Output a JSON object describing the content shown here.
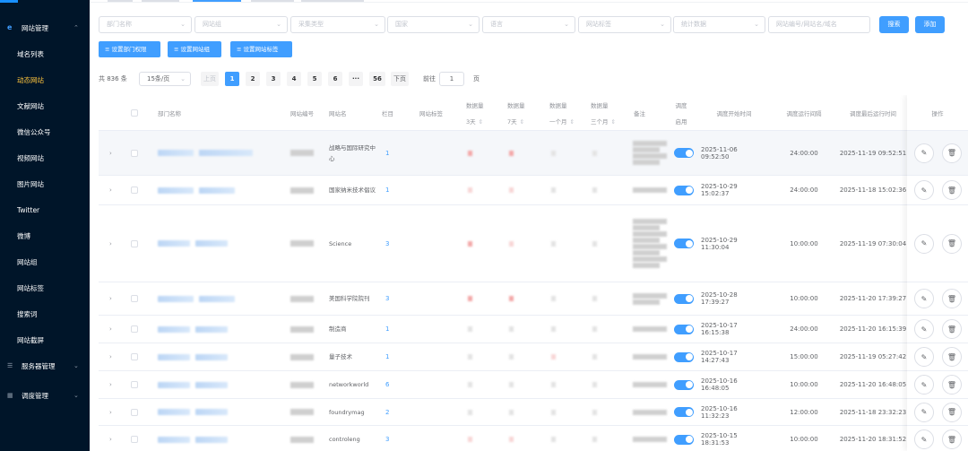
{
  "colors": {
    "primary": "#409eff",
    "sidebar_bg": "#001529",
    "active_menu": "#ffc53d"
  },
  "sidebar": {
    "top_menu": {
      "icon": "ie-icon",
      "label": "网站管理"
    },
    "items": [
      {
        "label": "域名列表",
        "active": false
      },
      {
        "label": "动态网站",
        "active": true
      },
      {
        "label": "文献网站",
        "active": false
      },
      {
        "label": "微信公众号",
        "active": false
      },
      {
        "label": "视频网站",
        "active": false
      },
      {
        "label": "图片网站",
        "active": false
      },
      {
        "label": "Twitter",
        "active": false
      },
      {
        "label": "微博",
        "active": false
      },
      {
        "label": "网站组",
        "active": false
      },
      {
        "label": "网站标签",
        "active": false
      },
      {
        "label": "搜索词",
        "active": false
      },
      {
        "label": "网站截屏",
        "active": false
      }
    ],
    "groups": [
      {
        "icon": "server-icon",
        "label": "服务器管理"
      },
      {
        "icon": "calendar-icon",
        "label": "调度管理"
      }
    ]
  },
  "filters": {
    "placeholders": [
      "部门名称",
      "网站组",
      "采集类型",
      "国家",
      "语言",
      "网站标签",
      "统计数据"
    ],
    "search_placeholder": "网站编号/网站名/域名",
    "search_label": "搜索",
    "add_label": "添加"
  },
  "actions": {
    "set_dept_perm": "设置部门权限",
    "set_site_group": "设置网站组",
    "set_site_tag": "设置网站标签"
  },
  "pager": {
    "total": "共 836 条",
    "page_size": "15条/页",
    "prev": "上页",
    "pages": [
      "1",
      "2",
      "3",
      "4",
      "5",
      "6",
      "···",
      "56"
    ],
    "next": "下页",
    "goto": "前往",
    "current": "1",
    "page_suffix": "页"
  },
  "table": {
    "headers": {
      "dept": "部门名称",
      "site_no": "网站编号",
      "site_name": "网站名",
      "column": "栏目",
      "tag": "网站标签",
      "d3_a": "数据量",
      "d3_b": "3天",
      "d7_a": "数据量",
      "d7_b": "7天",
      "d1m_a": "数据量",
      "d1m_b": "一个月",
      "d3m_a": "数据量",
      "d3m_b": "三个月",
      "remark": "备注",
      "sched_a": "调度",
      "sched_b": "启用",
      "start": "调度开始时间",
      "interval": "调度运行间隔",
      "last": "调度最后运行时间",
      "ops": "操作"
    },
    "rows": [
      {
        "name": "战略与国际研究中心",
        "column": "1",
        "start": "2025-11-06 09:52:50",
        "interval": "24:00:00",
        "last": "2025-11-19 09:52:51"
      },
      {
        "name": "国家纳米技术倡议",
        "column": "1",
        "start": "2025-10-29 15:02:37",
        "interval": "24:00:00",
        "last": "2025-11-18 15:02:36"
      },
      {
        "name": "Science",
        "column": "3",
        "start": "2025-10-29 11:30:04",
        "interval": "10:00:00",
        "last": "2025-11-19 07:30:04"
      },
      {
        "name": "美国科学院院刊",
        "column": "3",
        "start": "2025-10-28 17:39:27",
        "interval": "10:00:00",
        "last": "2025-11-20 17:39:27"
      },
      {
        "name": "制造商",
        "column": "1",
        "start": "2025-10-17 16:15:38",
        "interval": "24:00:00",
        "last": "2025-11-20 16:15:39"
      },
      {
        "name": "量子技术",
        "column": "1",
        "start": "2025-10-17 14:27:43",
        "interval": "15:00:00",
        "last": "2025-11-19 05:27:42"
      },
      {
        "name": "networkworld",
        "column": "6",
        "start": "2025-10-16 16:48:05",
        "interval": "10:00:00",
        "last": "2025-11-20 16:48:05"
      },
      {
        "name": "foundrymag",
        "column": "2",
        "start": "2025-10-16 11:32:23",
        "interval": "12:00:00",
        "last": "2025-11-18 23:32:23"
      },
      {
        "name": "controleng",
        "column": "3",
        "start": "2025-10-15 18:31:53",
        "interval": "10:00:00",
        "last": "2025-11-20 18:31:52"
      }
    ]
  }
}
